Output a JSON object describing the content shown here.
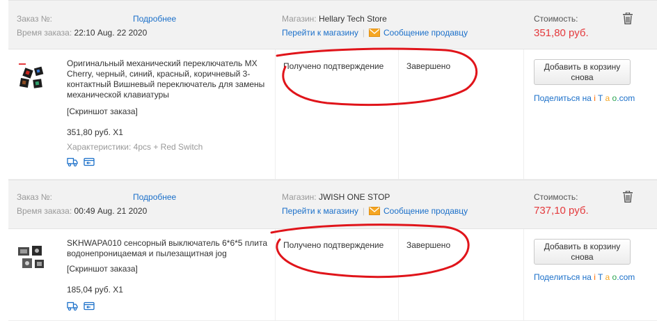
{
  "colors": {
    "link": "#1a6fc9",
    "price": "#e4393c",
    "header_bg": "#f2f2f2",
    "mail_icon": "#f5a623",
    "annotation": "#e0141a",
    "taobao_letters": [
      "#ff6a00",
      "#1a6fc9",
      "#f5a623",
      "#2aa44f"
    ]
  },
  "orders": [
    {
      "order_no_label": "Заказ №:",
      "details_link": "Подробнее",
      "order_time_label": "Время заказа:",
      "order_time": "22:10 Aug. 22 2020",
      "store_label": "Магазин:",
      "store_name": "Hellary Tech Store",
      "goto_store": "Перейти к магазину",
      "separator": "|",
      "message_seller": "Сообщение продавцу",
      "cost_label": "Стоимость:",
      "cost": "351,80 руб.",
      "product": {
        "title": "Оригинальный механический переключатель MX Cherry, черный, синий, красный, коричневый 3-контактный Вишневый переключатель для замены механической клавиатуры",
        "snapshot": "[Скриншот заказа]",
        "price_qty": "351,80 руб. X1",
        "specs": "Характеристики: 4pcs + Red Switch"
      },
      "status_confirm": "Получено подтверждение",
      "status_done": "Завершено",
      "add_to_cart": "Добавить в корзину снова",
      "share_prefix": "Поделиться на",
      "share_letters": [
        "i",
        "T",
        "a",
        "o",
        ".com"
      ]
    },
    {
      "order_no_label": "Заказ №:",
      "details_link": "Подробнее",
      "order_time_label": "Время заказа:",
      "order_time": "00:49 Aug. 21 2020",
      "store_label": "Магазин:",
      "store_name": "JWISH ONE STOP",
      "goto_store": "Перейти к магазину",
      "separator": "|",
      "message_seller": "Сообщение продавцу",
      "cost_label": "Стоимость:",
      "cost": "737,10 руб.",
      "product": {
        "title": "SKHWAPA010 сенсорный выключатель 6*6*5 плита водонепроницаемая и пылезащитная jog",
        "snapshot": "[Скриншот заказа]",
        "price_qty": "185,04 руб. X1"
      },
      "status_confirm": "Получено подтверждение",
      "status_done": "Завершено",
      "add_to_cart": "Добавить в корзину снова",
      "share_prefix": "Поделиться на",
      "share_letters": [
        "i",
        "T",
        "a",
        "o",
        ".com"
      ]
    }
  ]
}
